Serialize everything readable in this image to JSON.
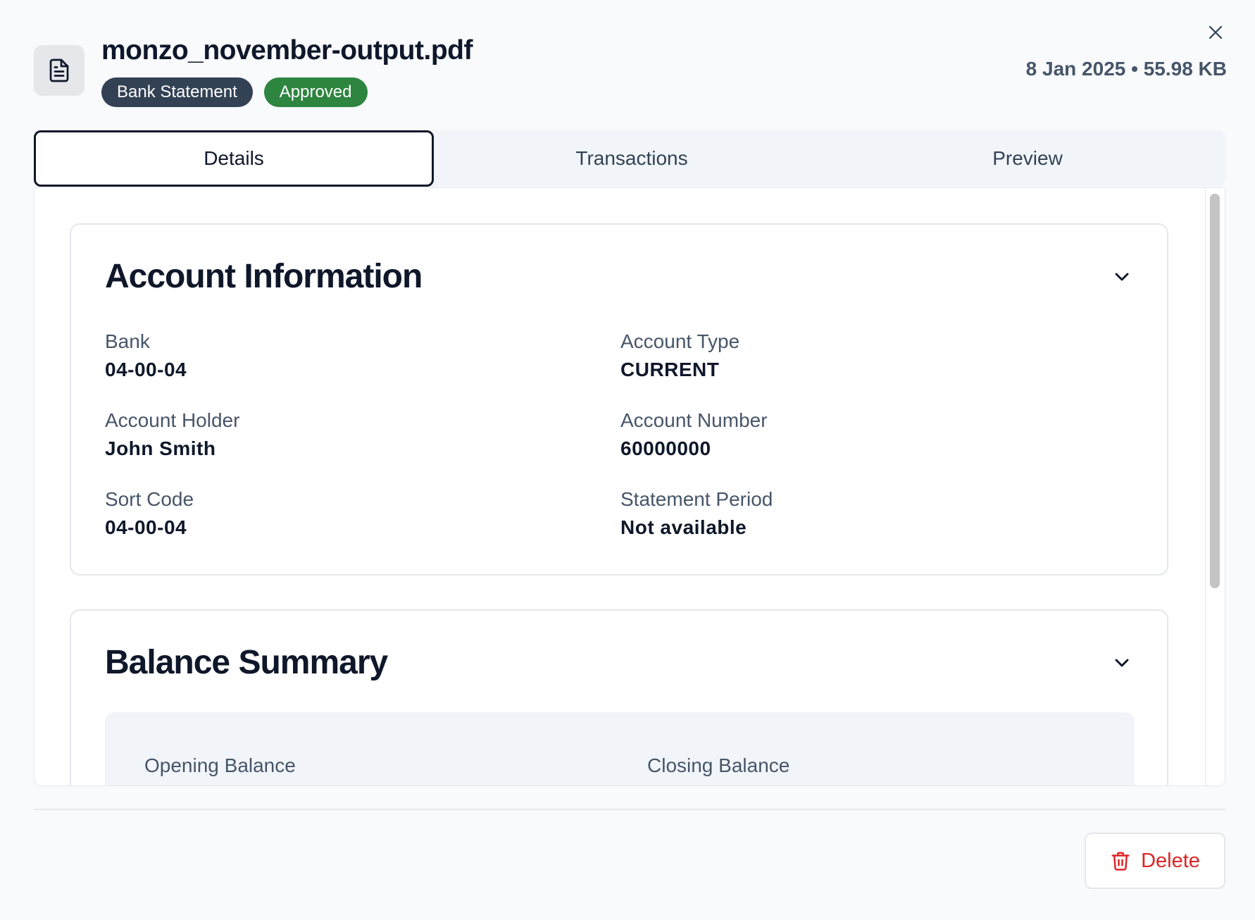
{
  "header": {
    "file_name": "monzo_november-output.pdf",
    "badge_type": "Bank Statement",
    "badge_status": "Approved",
    "meta": "8 Jan 2025 • 55.98 KB"
  },
  "tabs": [
    {
      "label": "Details"
    },
    {
      "label": "Transactions"
    },
    {
      "label": "Preview"
    }
  ],
  "account_info": {
    "title": "Account Information",
    "fields": [
      {
        "label": "Bank",
        "value": "04-00-04"
      },
      {
        "label": "Account Type",
        "value": "CURRENT"
      },
      {
        "label": "Account Holder",
        "value": "John Smith"
      },
      {
        "label": "Account Number",
        "value": "60000000"
      },
      {
        "label": "Sort Code",
        "value": "04-00-04"
      },
      {
        "label": "Statement Period",
        "value": "Not available"
      }
    ]
  },
  "balance_summary": {
    "title": "Balance Summary",
    "opening_label": "Opening Balance",
    "closing_label": "Closing Balance"
  },
  "footer": {
    "delete_label": "Delete"
  },
  "colors": {
    "badge_type": "#334155",
    "badge_status": "#2e8540",
    "danger": "#dc2626"
  },
  "icons": {
    "file": "file-text-icon",
    "close": "close-icon",
    "chevron": "chevron-down-icon",
    "trash": "trash-icon"
  }
}
